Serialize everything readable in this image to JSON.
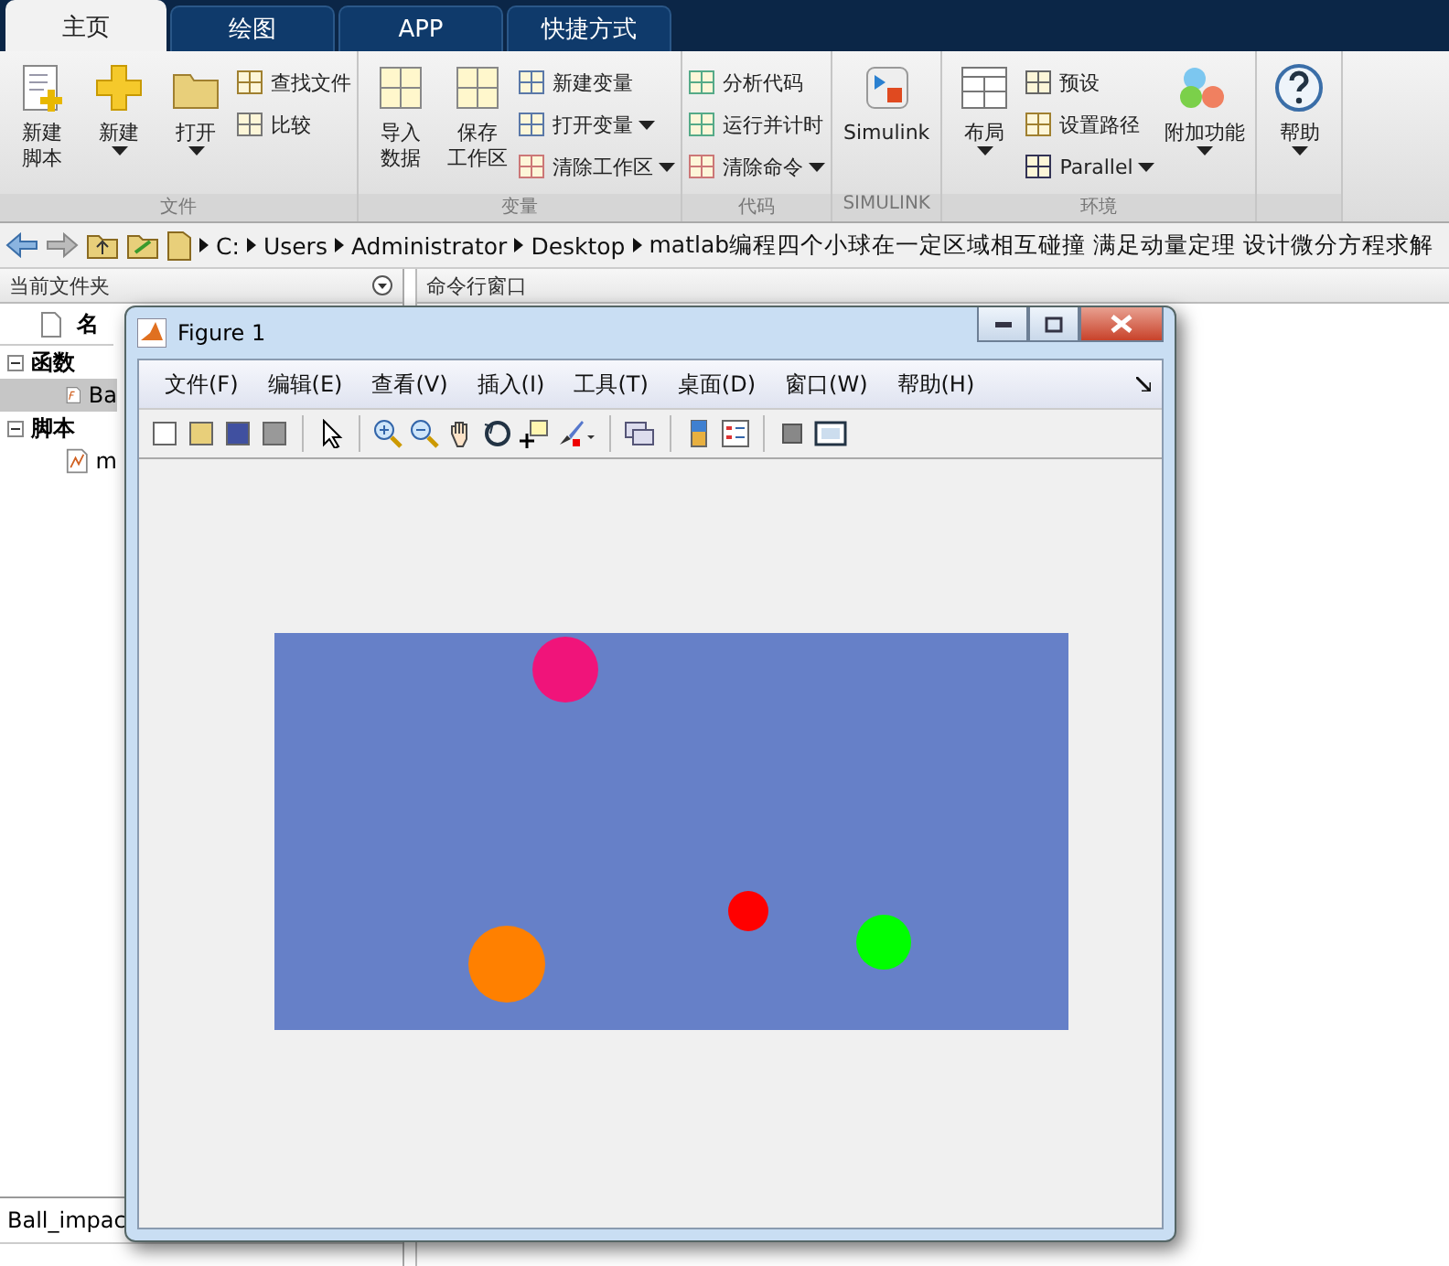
{
  "tabs": [
    {
      "label": "主页",
      "selected": true
    },
    {
      "label": "绘图",
      "selected": false
    },
    {
      "label": "APP",
      "selected": false
    },
    {
      "label": "快捷方式",
      "selected": false
    }
  ],
  "ribbon": {
    "groups": [
      {
        "label": "文件",
        "buttons": [
          {
            "kind": "large",
            "lines": [
              "新建",
              "脚本"
            ],
            "dropdown": false
          },
          {
            "kind": "large",
            "lines": [
              "新建"
            ],
            "dropdown": true
          },
          {
            "kind": "large",
            "lines": [
              "打开"
            ],
            "dropdown": true
          },
          {
            "kind": "small",
            "items": [
              {
                "label": "查找文件",
                "dropdown": false
              },
              {
                "label": "比较",
                "dropdown": false
              }
            ]
          }
        ]
      },
      {
        "label": "变量",
        "buttons": [
          {
            "kind": "large",
            "lines": [
              "导入",
              "数据"
            ],
            "dropdown": false
          },
          {
            "kind": "large",
            "lines": [
              "保存",
              "工作区"
            ],
            "dropdown": false
          },
          {
            "kind": "small",
            "items": [
              {
                "label": "新建变量",
                "dropdown": false
              },
              {
                "label": "打开变量",
                "dropdown": true
              },
              {
                "label": "清除工作区",
                "dropdown": true
              }
            ]
          }
        ]
      },
      {
        "label": "代码",
        "buttons": [
          {
            "kind": "small",
            "items": [
              {
                "label": "分析代码",
                "dropdown": false
              },
              {
                "label": "运行并计时",
                "dropdown": false
              },
              {
                "label": "清除命令",
                "dropdown": true
              }
            ]
          }
        ]
      },
      {
        "label": "SIMULINK",
        "buttons": [
          {
            "kind": "large",
            "lines": [
              "Simulink"
            ],
            "dropdown": false
          }
        ]
      },
      {
        "label": "环境",
        "buttons": [
          {
            "kind": "large",
            "lines": [
              "布局"
            ],
            "dropdown": true
          },
          {
            "kind": "small",
            "items": [
              {
                "label": "预设",
                "dropdown": false
              },
              {
                "label": "设置路径",
                "dropdown": false
              },
              {
                "label": "Parallel",
                "dropdown": true
              }
            ]
          },
          {
            "kind": "large",
            "lines": [
              "附加功能"
            ],
            "dropdown": true
          }
        ]
      },
      {
        "buttons": [
          {
            "kind": "large",
            "lines": [
              "帮助"
            ],
            "dropdown": true
          }
        ]
      }
    ]
  },
  "address": {
    "segments": [
      "C:",
      "Users",
      "Administrator",
      "Desktop",
      "matlab编程四个小球在一定区域相互碰撞 满足动量定理 设计微分方程求解"
    ]
  },
  "current_folder": {
    "title": "当前文件夹",
    "column": "名",
    "tree": [
      {
        "label": "函数",
        "expanded": true,
        "children": [
          {
            "label": "Ba",
            "kind": "function",
            "selected": true
          }
        ]
      },
      {
        "label": "脚本",
        "expanded": true,
        "children": [
          {
            "label": "m",
            "kind": "script",
            "selected": false
          }
        ]
      }
    ],
    "footer": "Ball_impac"
  },
  "command_window": {
    "title": "命令行窗口"
  },
  "figure": {
    "title": "Figure 1",
    "menu": [
      "文件(F)",
      "编辑(E)",
      "查看(V)",
      "插入(I)",
      "工具(T)",
      "桌面(D)",
      "窗口(W)",
      "帮助(H)"
    ]
  }
}
